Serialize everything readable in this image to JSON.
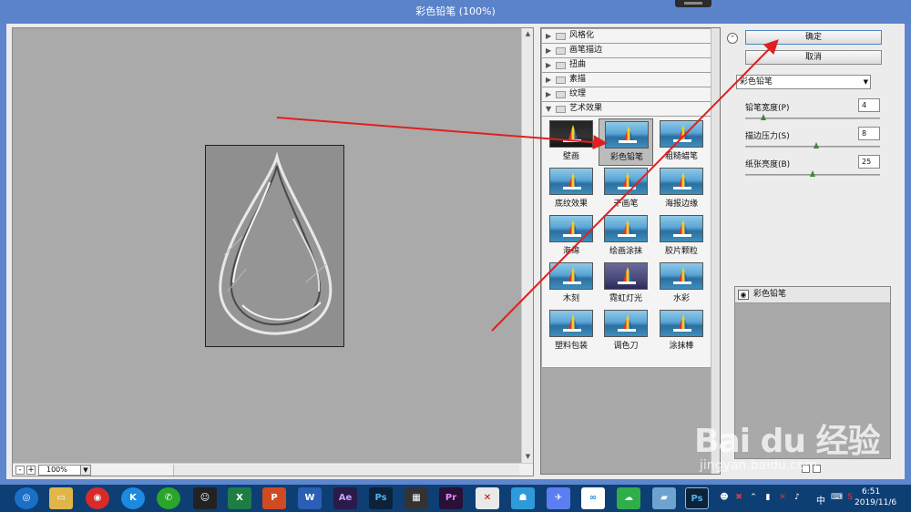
{
  "window": {
    "title": "彩色铅笔 (100%)"
  },
  "preview": {
    "zoom": "100%",
    "zoom_out": "-",
    "zoom_in": "+"
  },
  "gallery": {
    "categories": [
      {
        "label": "风格化",
        "expanded": false
      },
      {
        "label": "画笔描边",
        "expanded": false
      },
      {
        "label": "扭曲",
        "expanded": false
      },
      {
        "label": "素描",
        "expanded": false
      },
      {
        "label": "纹理",
        "expanded": false
      },
      {
        "label": "艺术效果",
        "expanded": true
      }
    ],
    "thumbs": [
      {
        "label": "壁画"
      },
      {
        "label": "彩色铅笔",
        "selected": true
      },
      {
        "label": "粗糙蜡笔"
      },
      {
        "label": "底纹效果"
      },
      {
        "label": "干画笔"
      },
      {
        "label": "海报边缘"
      },
      {
        "label": "海绵"
      },
      {
        "label": "绘画涂抹"
      },
      {
        "label": "胶片颗粒"
      },
      {
        "label": "木刻"
      },
      {
        "label": "霓虹灯光"
      },
      {
        "label": "水彩"
      },
      {
        "label": "塑料包装"
      },
      {
        "label": "调色刀"
      },
      {
        "label": "涂抹棒"
      }
    ]
  },
  "settings": {
    "ok_label": "确定",
    "cancel_label": "取消",
    "filter": "彩色铅笔",
    "params": [
      {
        "label": "铅笔宽度(P)",
        "value": "4",
        "fraction": 0.12
      },
      {
        "label": "描边压力(S)",
        "value": "8",
        "fraction": 0.53
      },
      {
        "label": "纸张亮度(B)",
        "value": "25",
        "fraction": 0.5
      }
    ]
  },
  "layers": {
    "items": [
      {
        "name": "彩色铅笔"
      }
    ]
  },
  "taskbar": {
    "apps": [
      "Ae",
      "Ps",
      "Pr",
      "W",
      "P",
      "X"
    ],
    "ime": "中",
    "time": "6:51",
    "date": "2019/11/6"
  },
  "watermark": {
    "logo": "Bai du 经验",
    "url": "jingyan.baidu.com"
  },
  "colors": {
    "title_bar": "#5b83ca",
    "taskbar": "#0d3f74",
    "arrow": "#e02020"
  }
}
